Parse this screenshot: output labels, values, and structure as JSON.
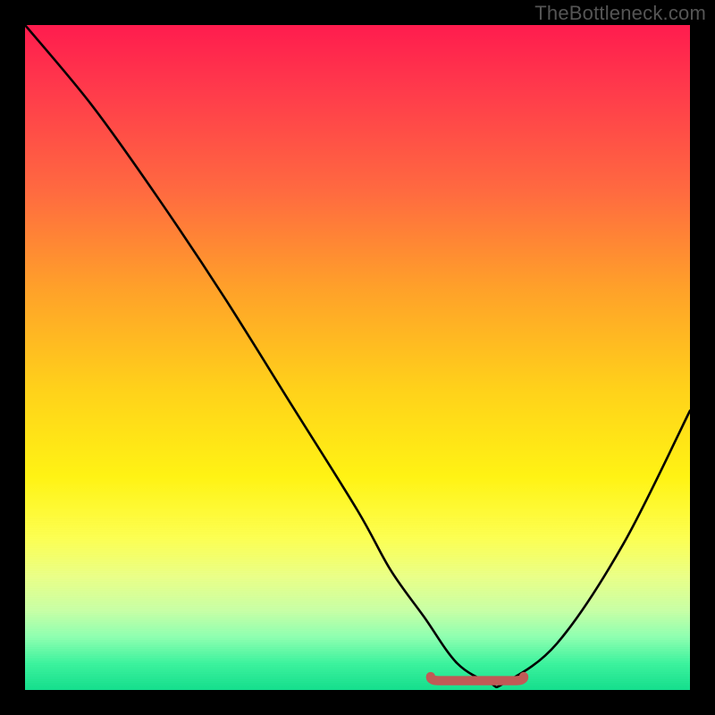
{
  "attribution": "TheBottleneck.com",
  "chart_data": {
    "type": "line",
    "title": "",
    "xlabel": "",
    "ylabel": "",
    "xlim": [
      0,
      100
    ],
    "ylim": [
      0,
      100
    ],
    "gradient_colors_top_to_bottom": [
      "#ff1c4e",
      "#ff6a40",
      "#ffd21a",
      "#fdff50",
      "#3cf39d",
      "#14de8c"
    ],
    "series": [
      {
        "name": "bottleneck-curve",
        "x": [
          0,
          10,
          20,
          30,
          40,
          50,
          55,
          60,
          65,
          70,
          72,
          80,
          90,
          100
        ],
        "values": [
          100,
          88,
          74,
          59,
          43,
          27,
          18,
          11,
          4,
          1,
          1,
          7,
          22,
          42
        ]
      }
    ],
    "trough_marker": {
      "name": "optimal-band",
      "x_start": 61,
      "x_end": 75,
      "y": 1.4,
      "color": "#c05a56"
    }
  }
}
